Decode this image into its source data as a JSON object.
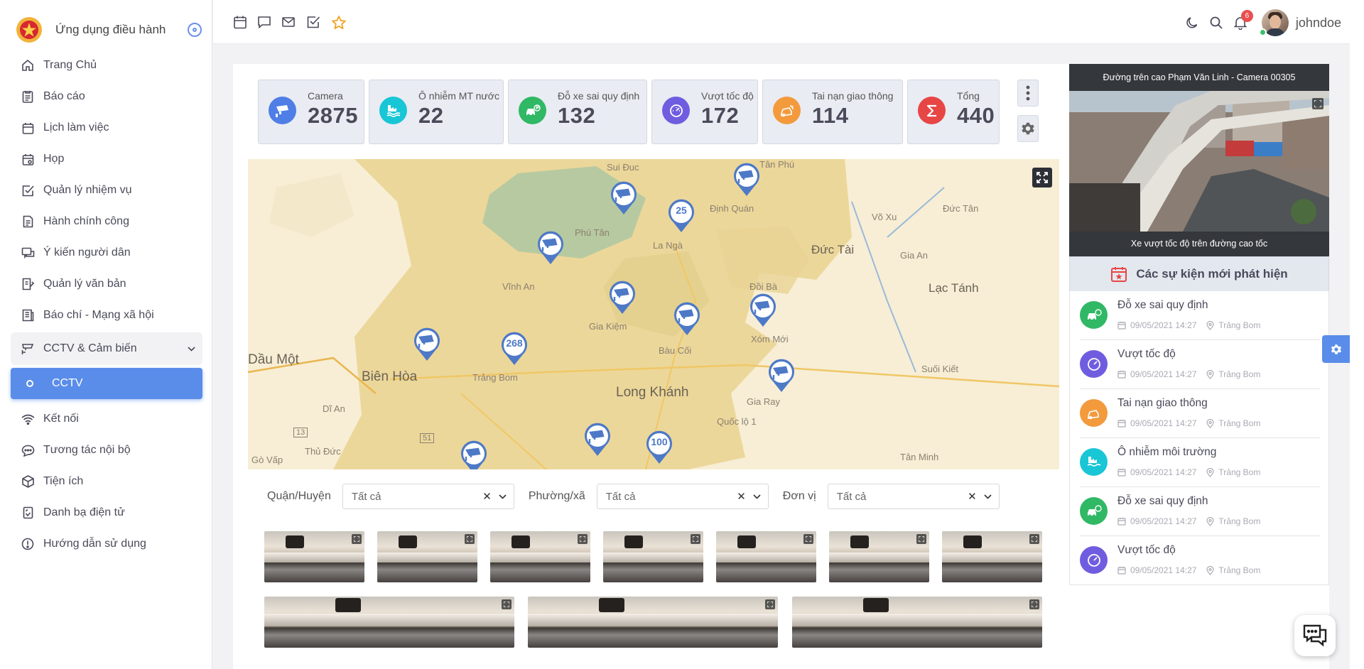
{
  "app": {
    "title": "Ứng dụng điều hành"
  },
  "sidebar": {
    "items": [
      {
        "label": "Trang Chủ",
        "icon": "home-icon"
      },
      {
        "label": "Báo cáo",
        "icon": "report-icon"
      },
      {
        "label": "Lịch làm việc",
        "icon": "calendar-icon"
      },
      {
        "label": "Họp",
        "icon": "meeting-icon"
      },
      {
        "label": "Quản lý nhiệm vụ",
        "icon": "task-icon"
      },
      {
        "label": "Hành chính công",
        "icon": "document-icon"
      },
      {
        "label": "Ý kiến người dân",
        "icon": "feedback-icon"
      },
      {
        "label": "Quản lý văn bản",
        "icon": "docs-icon"
      },
      {
        "label": "Báo chí - Mạng xã hội",
        "icon": "news-icon"
      }
    ],
    "open_group": {
      "label": "CCTV & Cảm biến",
      "icon": "cctv-icon"
    },
    "active_sub": "CCTV",
    "items_after": [
      {
        "label": "Kết nối",
        "icon": "wifi-icon"
      },
      {
        "label": "Tương tác nội bộ",
        "icon": "chat-icon"
      },
      {
        "label": "Tiện ích",
        "icon": "box-icon"
      },
      {
        "label": "Danh bạ điện tử",
        "icon": "contacts-icon"
      },
      {
        "label": "Hướng dẫn sử dụng",
        "icon": "info-icon"
      }
    ]
  },
  "topbar": {
    "username": "johndoe",
    "notification_count": "6"
  },
  "stats": [
    {
      "label": "Camera",
      "value": "2875",
      "color": "#4f7ee6"
    },
    {
      "label": "Ô nhiễm MT nước",
      "value": "22",
      "color": "#18c6d6"
    },
    {
      "label": "Đỗ xe sai quy định",
      "value": "132",
      "color": "#30b865"
    },
    {
      "label": "Vượt tốc độ",
      "value": "172",
      "color": "#6f5de0"
    },
    {
      "label": "Tai nạn giao thông",
      "value": "114",
      "color": "#f39a3d"
    },
    {
      "label": "Tổng",
      "value": "440",
      "color": "#e84545"
    }
  ],
  "map": {
    "labels": [
      "Sui Đuc",
      "Tân Phú",
      "Định Quán",
      "Võ Xu",
      "Đức Tân",
      "La Ngà",
      "Phú Tân",
      "Đức Tài",
      "Gia An",
      "Lạc Tánh",
      "Vĩnh An",
      "Đồi Bà",
      "Gia Kiệm",
      "Bàu Cối",
      "Xóm Mới",
      "Dầu Một",
      "Biên Hòa",
      "Trảng Bom",
      "Long Khánh",
      "Suối Kiết",
      "Gia Ray",
      "Dĩ An",
      "Quốc lộ 1",
      "Thủ Đức",
      "Gò Vấp",
      "Tân Minh",
      "13",
      "51"
    ],
    "clusters": [
      "25",
      "268",
      "100"
    ]
  },
  "filters": [
    {
      "label": "Quận/Huyện",
      "value": "Tất cả"
    },
    {
      "label": "Phường/xã",
      "value": "Tất cả"
    },
    {
      "label": "Đơn vị",
      "value": "Tất cả"
    }
  ],
  "video": {
    "title": "Đường trên cao Phạm Văn Linh - Camera 00305",
    "caption": "Xe vượt tốc độ trên đường cao tốc"
  },
  "events": {
    "title": "Các sự kiện mới phát hiện",
    "items": [
      {
        "title": "Đỗ xe sai quy định",
        "time": "09/05/2021 14:27",
        "place": "Trảng Bom",
        "color": "#30b865"
      },
      {
        "title": "Vượt tốc độ",
        "time": "09/05/2021 14:27",
        "place": "Trảng Bom",
        "color": "#6f5de0"
      },
      {
        "title": "Tai nạn giao thông",
        "time": "09/05/2021 14:27",
        "place": "Trảng Bom",
        "color": "#f39a3d"
      },
      {
        "title": "Ô nhiễm môi trường",
        "time": "09/05/2021 14:27",
        "place": "Trảng Bom",
        "color": "#18c6d6"
      },
      {
        "title": "Đỗ xe sai quy định",
        "time": "09/05/2021 14:27",
        "place": "Trảng Bom",
        "color": "#30b865"
      },
      {
        "title": "Vượt tốc độ",
        "time": "09/05/2021 14:27",
        "place": "Trảng Bom",
        "color": "#6f5de0"
      }
    ]
  }
}
